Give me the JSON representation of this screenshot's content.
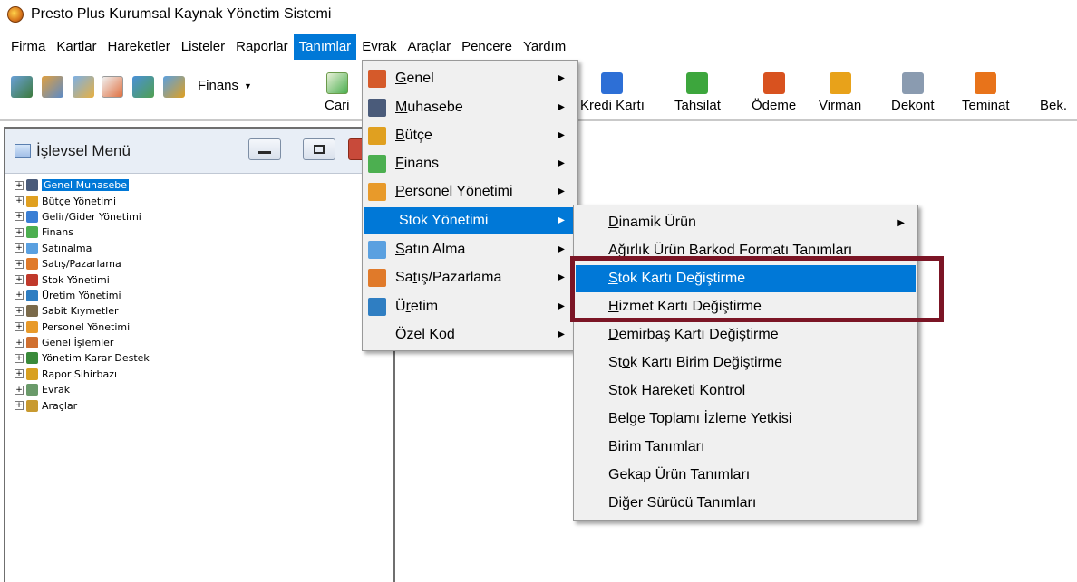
{
  "app": {
    "title": "Presto Plus Kurumsal Kaynak Yönetim Sistemi"
  },
  "menubar": [
    {
      "label": "Firma",
      "u": 0
    },
    {
      "label": "Kartlar",
      "u": 2
    },
    {
      "label": "Hareketler",
      "u": 0
    },
    {
      "label": "Listeler",
      "u": 0
    },
    {
      "label": "Raporlar",
      "u": 3
    },
    {
      "label": "Tanımlar",
      "u": 0,
      "active": true
    },
    {
      "label": "Evrak",
      "u": 0
    },
    {
      "label": "Araçlar",
      "u": 4
    },
    {
      "label": "Pencere",
      "u": 0
    },
    {
      "label": "Yardım",
      "u": 3
    }
  ],
  "toolbar": {
    "finans_label": "Finans",
    "finans_arrow": "▼",
    "cari_label": "Cari",
    "buttons": [
      {
        "label": "Kredi Kartı",
        "icon": "credit-card-icon",
        "color": "#2d6fd6"
      },
      {
        "label": "Tahsilat",
        "icon": "collection-icon",
        "color": "#3da63d"
      },
      {
        "label": "Ödeme",
        "icon": "payment-icon",
        "color": "#d8521f"
      },
      {
        "label": "Virman",
        "icon": "transfer-icon",
        "color": "#e8a21a"
      },
      {
        "label": "Dekont",
        "icon": "voucher-icon",
        "color": "#8a9bb0"
      },
      {
        "label": "Teminat",
        "icon": "umbrella-icon",
        "color": "#e8731a"
      },
      {
        "label": "Bek.",
        "icon": "",
        "color": ""
      }
    ]
  },
  "panel": {
    "title": "İşlevsel Menü",
    "tree": [
      {
        "label": "Genel Muhasebe",
        "icon": "ledger-icon",
        "color": "#4a5b7a",
        "selected": true
      },
      {
        "label": "Bütçe Yönetimi",
        "icon": "budget-icon",
        "color": "#e0a020"
      },
      {
        "label": "Gelir/Gider Yönetimi",
        "icon": "income-expense-icon",
        "color": "#3a7fd5"
      },
      {
        "label": "Finans",
        "icon": "finance-icon",
        "color": "#4caf50"
      },
      {
        "label": "Satınalma",
        "icon": "purchasing-icon",
        "color": "#5aa0e0"
      },
      {
        "label": "Satış/Pazarlama",
        "icon": "sales-icon",
        "color": "#e07a2a"
      },
      {
        "label": "Stok Yönetimi",
        "icon": "stock-icon",
        "color": "#c0392b"
      },
      {
        "label": "Üretim Yönetimi",
        "icon": "production-icon",
        "color": "#2f7ec2"
      },
      {
        "label": "Sabit Kıymetler",
        "icon": "fixed-assets-icon",
        "color": "#7a6a4a"
      },
      {
        "label": "Personel Yönetimi",
        "icon": "personnel-icon",
        "color": "#e89a2a"
      },
      {
        "label": "Genel İşlemler",
        "icon": "general-ops-icon",
        "color": "#d07030"
      },
      {
        "label": "Yönetim Karar Destek",
        "icon": "decision-support-icon",
        "color": "#3a8a3a"
      },
      {
        "label": "Rapor Sihirbazı",
        "icon": "report-wizard-icon",
        "color": "#d8a020"
      },
      {
        "label": "Evrak",
        "icon": "document-icon",
        "color": "#6a9a6a"
      },
      {
        "label": "Araçlar",
        "icon": "tools-icon",
        "color": "#c89a30"
      }
    ]
  },
  "tanimlar_menu": [
    {
      "label": "Genel",
      "u": 0,
      "icon": "grid-icon",
      "color": "#d55a2a",
      "arrow": "▶"
    },
    {
      "label": "Muhasebe",
      "u": 0,
      "icon": "ledger-icon",
      "color": "#4a5b7a",
      "arrow": "▶"
    },
    {
      "label": "Bütçe",
      "u": 0,
      "icon": "budget-icon",
      "color": "#e0a020",
      "arrow": "▶"
    },
    {
      "label": "Finans",
      "u": 0,
      "icon": "finance-icon",
      "color": "#4caf50",
      "arrow": "▶"
    },
    {
      "label": "Personel Yönetimi",
      "u": 0,
      "icon": "personnel-icon",
      "color": "#e89a2a",
      "arrow": "▶"
    },
    {
      "label": "Stok Yönetimi",
      "u": -1,
      "icon": "",
      "color": "",
      "arrow": "▶",
      "highlighted": true
    },
    {
      "label": "Satın Alma",
      "u": 0,
      "icon": "purchasing-icon",
      "color": "#5aa0e0",
      "arrow": "▶"
    },
    {
      "label": "Satış/Pazarlama",
      "u": 2,
      "icon": "sales-icon",
      "color": "#e07a2a",
      "arrow": "▶"
    },
    {
      "label": "Üretim",
      "u": 1,
      "icon": "wrench-icon",
      "color": "#2f7ec2",
      "arrow": "▶"
    },
    {
      "label": "Özel Kod",
      "u": -1,
      "icon": "",
      "color": "",
      "arrow": "▶"
    }
  ],
  "stok_submenu": [
    {
      "label": "Dinamik Ürün",
      "u": 0,
      "arrow": "▶"
    },
    {
      "label": "Ağırlık Ürün Barkod Formatı Tanımları",
      "u": 1,
      "arrow": ""
    },
    {
      "label": "Stok Kartı Değiştirme",
      "u": 0,
      "arrow": "",
      "highlighted": true
    },
    {
      "label": "Hizmet Kartı Değiştirme",
      "u": 0,
      "arrow": ""
    },
    {
      "label": "Demirbaş Kartı Değiştirme",
      "u": 0,
      "arrow": ""
    },
    {
      "label": "Stok Kartı Birim Değiştirme",
      "u": 2,
      "arrow": ""
    },
    {
      "label": "Stok Hareketi Kontrol",
      "u": 1,
      "arrow": ""
    },
    {
      "label": "Belge Toplamı İzleme Yetkisi",
      "u": -1,
      "arrow": ""
    },
    {
      "label": "Birim Tanımları",
      "u": -1,
      "arrow": ""
    },
    {
      "label": "Gekap Ürün Tanımları",
      "u": -1,
      "arrow": ""
    },
    {
      "label": "Diğer Sürücü Tanımları",
      "u": -1,
      "arrow": ""
    }
  ],
  "colors": {
    "accent": "#0078d7",
    "highlight_box": "#7b1525"
  }
}
